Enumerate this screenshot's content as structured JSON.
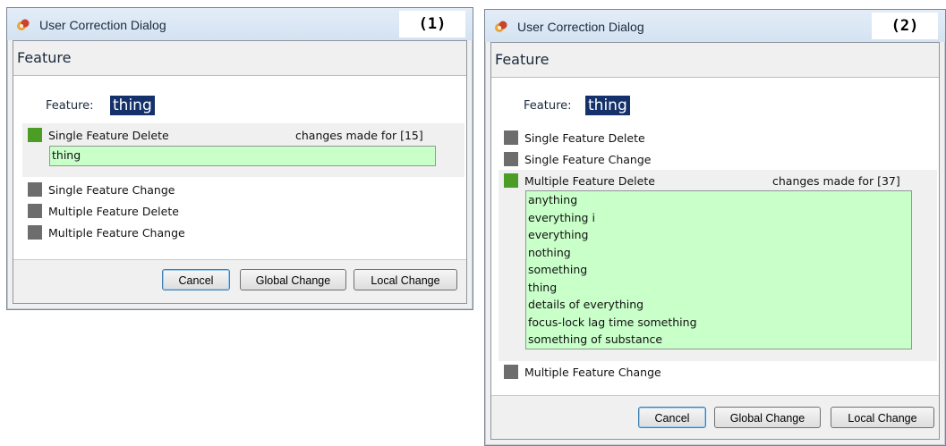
{
  "dialogs": [
    {
      "number": "(1)",
      "title": "User Correction Dialog",
      "panel_title": "Feature",
      "feature_label": "Feature:",
      "feature_value": "thing",
      "options": [
        {
          "label": "Single Feature Delete",
          "selected": true
        },
        {
          "label": "Single Feature Change",
          "selected": false
        },
        {
          "label": "Multiple Feature Delete",
          "selected": false
        },
        {
          "label": "Multiple Feature Change",
          "selected": false
        }
      ],
      "changes_text": "changes made for [15]",
      "list_items": [
        "thing"
      ],
      "buttons": {
        "cancel": "Cancel",
        "global": "Global Change",
        "local": "Local Change"
      }
    },
    {
      "number": "(2)",
      "title": "User Correction Dialog",
      "panel_title": "Feature",
      "feature_label": "Feature:",
      "feature_value": "thing",
      "options": [
        {
          "label": "Single Feature Delete",
          "selected": false
        },
        {
          "label": "Single Feature Change",
          "selected": false
        },
        {
          "label": "Multiple Feature Delete",
          "selected": true
        },
        {
          "label": "Multiple Feature Change",
          "selected": false
        }
      ],
      "changes_text": "changes made for [37]",
      "list_items": [
        "anything",
        "everything i",
        "everything",
        "nothing",
        "something",
        "thing",
        "details of everything",
        "focus-lock lag time something",
        "something of substance"
      ],
      "buttons": {
        "cancel": "Cancel",
        "global": "Global Change",
        "local": "Local Change"
      }
    }
  ],
  "colors": {
    "selected_indicator": "#4b9d25",
    "unselected_indicator": "#6d6d6d",
    "list_bg": "#c9ffc9",
    "feature_highlight": "#15316b"
  }
}
